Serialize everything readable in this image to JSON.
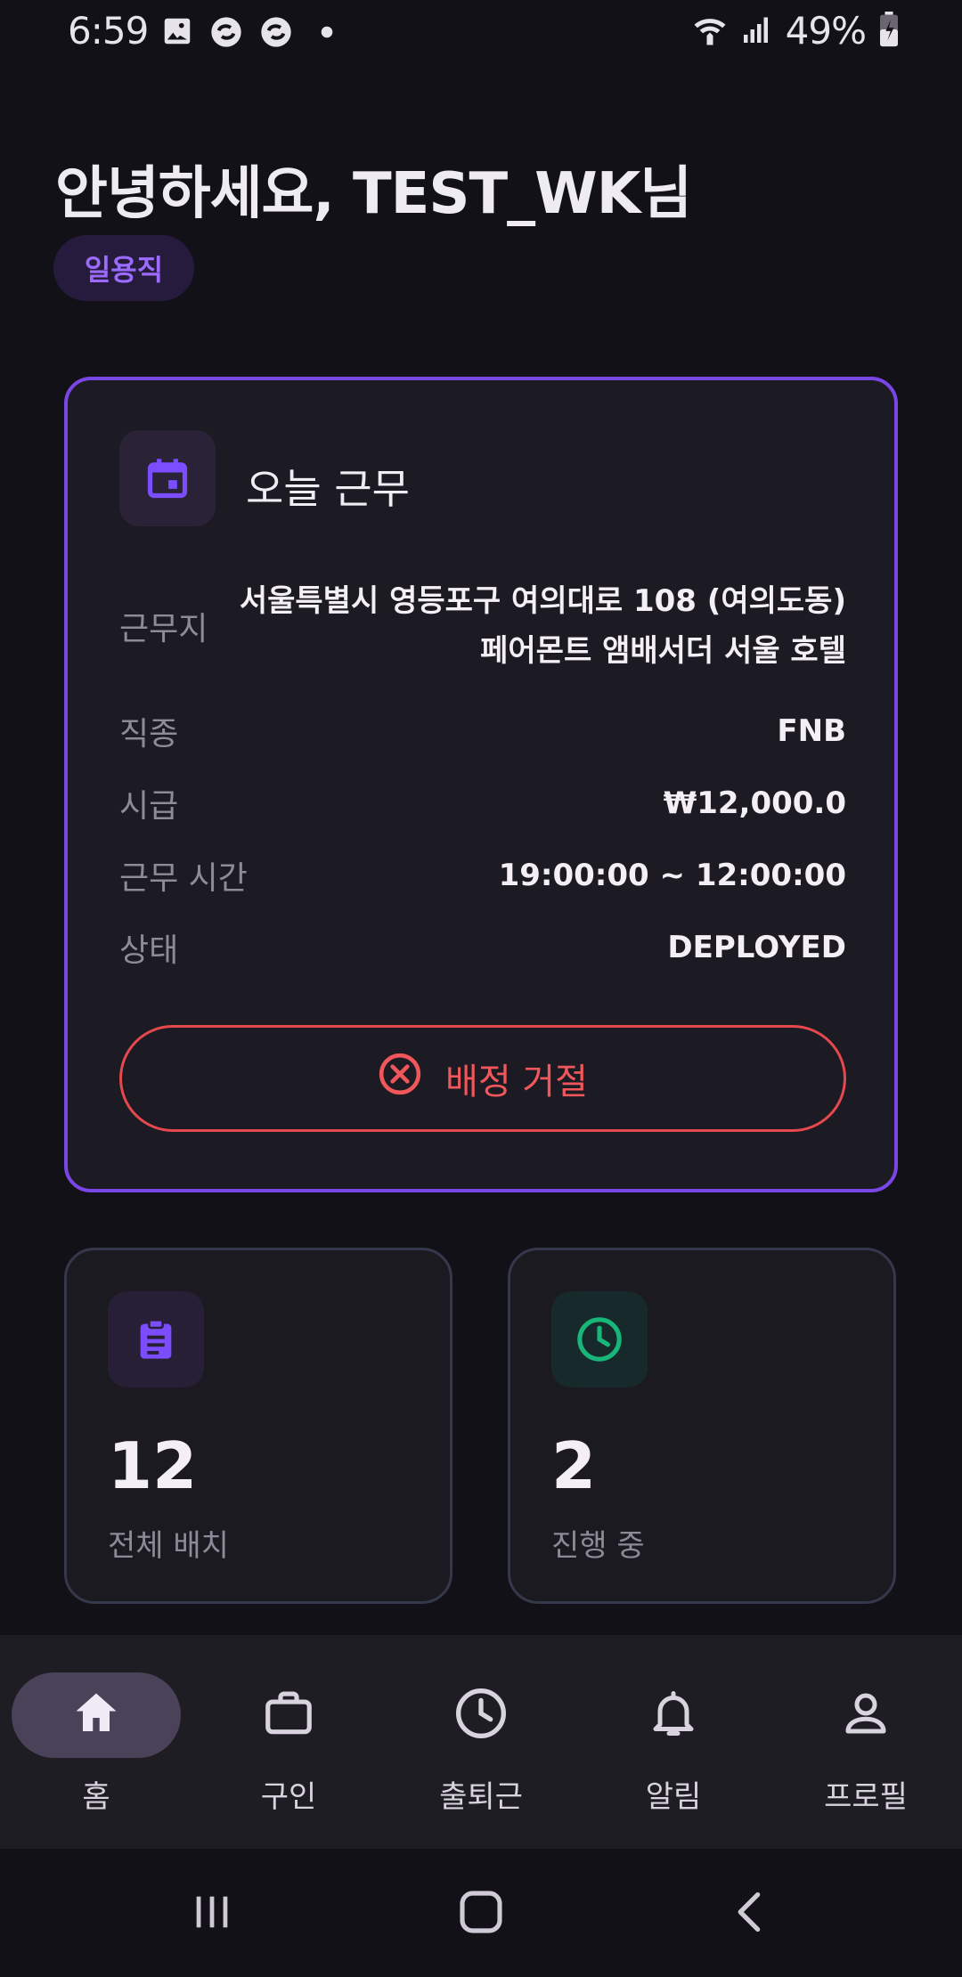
{
  "status_bar": {
    "time": "6:59",
    "battery": "49%",
    "icons": [
      "gallery-icon",
      "sync-icon",
      "sync-icon",
      "dot-icon",
      "wifi-icon",
      "signal-icon",
      "battery-icon"
    ]
  },
  "greeting": "안녕하세요, TEST_WK님",
  "role_chip": "일용직",
  "today_card": {
    "title": "오늘 근무",
    "icon": "calendar-icon",
    "rows": [
      {
        "label": "근무지",
        "value": "서울특별시 영등포구 여의대로 108 (여의도동) 페어몬트 앰배서더 서울 호텔"
      },
      {
        "label": "직종",
        "value": "FNB"
      },
      {
        "label": "시급",
        "value": "₩12,000.0"
      },
      {
        "label": "근무 시간",
        "value": "19:00:00 ~ 12:00:00"
      },
      {
        "label": "상태",
        "value": "DEPLOYED"
      }
    ],
    "reject_button": "배정 거절"
  },
  "stats": [
    {
      "number": "12",
      "label": "전체 배치",
      "icon": "clipboard-icon",
      "accent": "#7C4DFF"
    },
    {
      "number": "2",
      "label": "진행 중",
      "icon": "clock-icon",
      "accent": "#19B67A"
    }
  ],
  "bottom_nav": [
    {
      "label": "홈",
      "icon": "home-icon",
      "active": true
    },
    {
      "label": "구인",
      "icon": "briefcase-icon",
      "active": false
    },
    {
      "label": "출퇴근",
      "icon": "clock-icon",
      "active": false
    },
    {
      "label": "알림",
      "icon": "bell-icon",
      "active": false
    },
    {
      "label": "프로필",
      "icon": "person-icon",
      "active": false
    }
  ],
  "colors": {
    "background": "#131118",
    "accent_purple": "#7A46E6",
    "danger": "#E5484D",
    "success": "#19B67A"
  }
}
